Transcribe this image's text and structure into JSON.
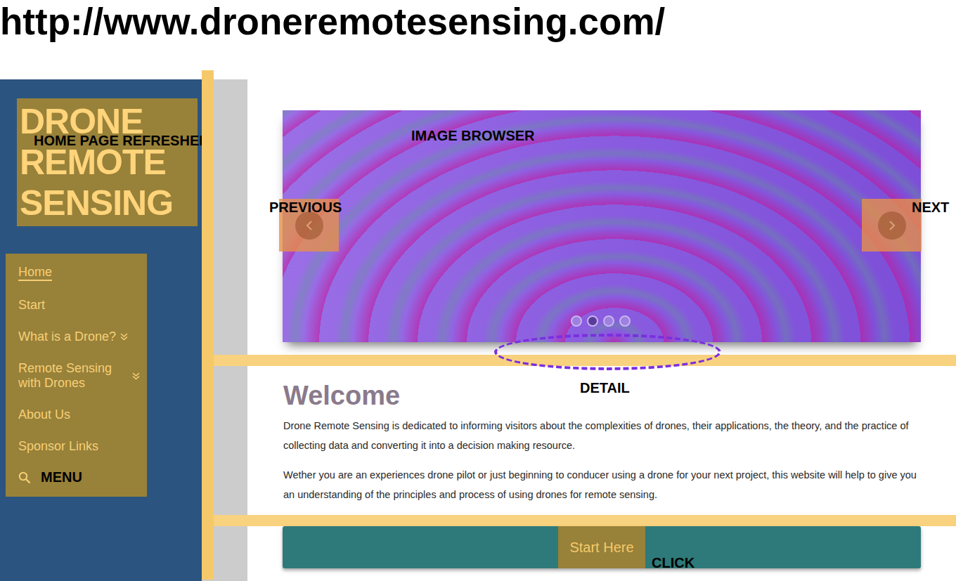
{
  "url": "http://www.droneremotesensing.com/",
  "logo": {
    "text": "DRONE REMOTE SENSING",
    "annotation": "HOME PAGE REFRESHER"
  },
  "nav": {
    "items": [
      {
        "label": "Home",
        "selected": true,
        "expandable": false
      },
      {
        "label": "Start",
        "selected": false,
        "expandable": false
      },
      {
        "label": "What is a Drone?",
        "selected": false,
        "expandable": true
      },
      {
        "label": "Remote Sensing with Drones",
        "selected": false,
        "expandable": true
      },
      {
        "label": "About Us",
        "selected": false,
        "expandable": false
      },
      {
        "label": "Sponsor Links",
        "selected": false,
        "expandable": false
      }
    ],
    "annotation": "MENU"
  },
  "carousel": {
    "annotation": "IMAGE BROWSER",
    "previous": "PREVIOUS",
    "next": "NEXT",
    "detail": "DETAIL",
    "dots": [
      {
        "selected": false
      },
      {
        "selected": true
      },
      {
        "selected": false
      },
      {
        "selected": false
      }
    ]
  },
  "welcome": {
    "title": "Welcome",
    "paragraphs": [
      "Drone Remote Sensing is dedicated to informing visitors about the complexities of drones, their applications, the theory, and the practice of collecting data and converting it into a decision making resource.",
      "Wether you are an experiences drone pilot or just beginning to conducer using a drone for your next project, this website will help to give you an understanding of the principles and process of using drones for remote sensing."
    ]
  },
  "cta": {
    "label": "Start Here",
    "annotation": "CLICK"
  }
}
